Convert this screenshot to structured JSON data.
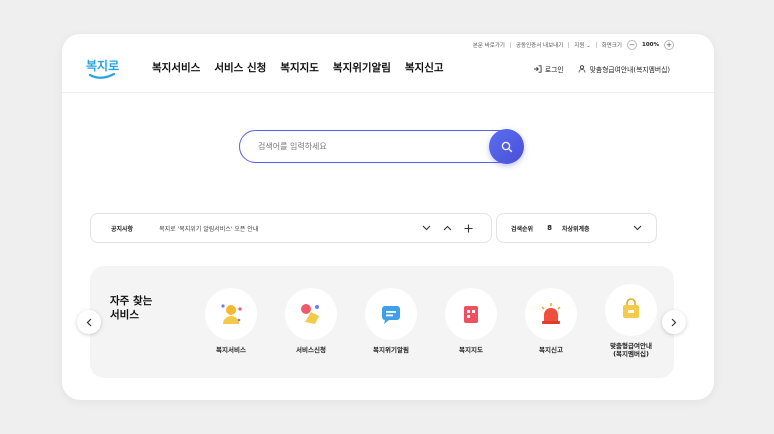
{
  "util_bar": {
    "skip_link": "본문 바로가기",
    "cert_export": "공동인증서 내보내기",
    "support": "지원",
    "zoom_label": "화면크기",
    "zoom_minus": "−",
    "zoom_value": "100%",
    "zoom_plus": "+"
  },
  "logo": {
    "text": "복지로"
  },
  "nav": {
    "items": [
      "복지서비스",
      "서비스 신청",
      "복지지도",
      "복지위기알림",
      "복지신고"
    ]
  },
  "header_right": {
    "login": "로그인",
    "membership": "맞춤형급여안내(복지멤버십)"
  },
  "search": {
    "placeholder": "검색어를 입력하세요"
  },
  "notice": {
    "label": "공지사항",
    "text": "복지로 '복지위기 알림서비스' 오픈 안내"
  },
  "ranking": {
    "label": "검색순위",
    "rank": "8",
    "keyword": "차상위계층"
  },
  "frequent": {
    "title_line1": "자주 찾는",
    "title_line2": "서비스",
    "items": [
      {
        "label": "복지서비스",
        "icon": "person-icon"
      },
      {
        "label": "서비스신청",
        "icon": "hand-icon"
      },
      {
        "label": "복지위기알림",
        "icon": "chat-icon"
      },
      {
        "label": "복지지도",
        "icon": "building-icon"
      },
      {
        "label": "복지신고",
        "icon": "siren-icon"
      },
      {
        "label": "맞춤형급여안내\n(복지멤버십)",
        "icon": "bag-icon"
      }
    ]
  },
  "colors": {
    "accent": "#4a4fd8",
    "logo_blue": "#2aa4e0",
    "background": "#efefef"
  }
}
